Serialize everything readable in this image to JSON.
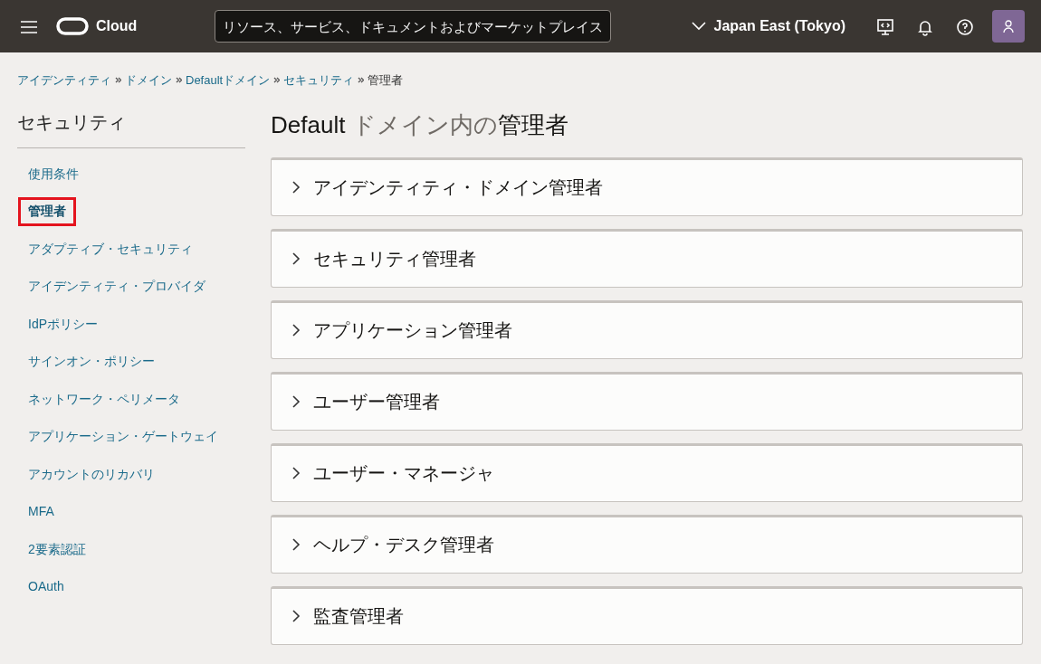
{
  "header": {
    "brand": "Cloud",
    "search": {
      "placeholder": "リソース、サービス、ドキュメントおよびマーケットプレイス"
    },
    "region": "Japan East (Tokyo)"
  },
  "breadcrumb": [
    {
      "label": "アイデンティティ",
      "link": true
    },
    {
      "label": "ドメイン",
      "link": true
    },
    {
      "label": "Defaultドメイン",
      "link": true
    },
    {
      "label": "セキュリティ",
      "link": true
    },
    {
      "label": "管理者",
      "link": false
    }
  ],
  "sidebar": {
    "title": "セキュリティ",
    "items": [
      {
        "label": "使用条件",
        "selected": false
      },
      {
        "label": "管理者",
        "selected": true
      },
      {
        "label": "アダプティブ・セキュリティ",
        "selected": false
      },
      {
        "label": "アイデンティティ・プロバイダ",
        "selected": false
      },
      {
        "label": "IdPポリシー",
        "selected": false
      },
      {
        "label": "サインオン・ポリシー",
        "selected": false
      },
      {
        "label": "ネットワーク・ペリメータ",
        "selected": false
      },
      {
        "label": "アプリケーション・ゲートウェイ",
        "selected": false
      },
      {
        "label": "アカウントのリカバリ",
        "selected": false
      },
      {
        "label": "MFA",
        "selected": false
      },
      {
        "label": "2要素認証",
        "selected": false
      },
      {
        "label": "OAuth",
        "selected": false
      }
    ]
  },
  "title_parts": [
    {
      "text": "Default ",
      "muted": false
    },
    {
      "text": "ドメイン内の",
      "muted": true
    },
    {
      "text": "管理者",
      "muted": false
    }
  ],
  "sections": [
    {
      "label": "アイデンティティ・ドメイン管理者",
      "expanded": false
    },
    {
      "label": "セキュリティ管理者",
      "expanded": false
    },
    {
      "label": "アプリケーション管理者",
      "expanded": false
    },
    {
      "label": "ユーザー管理者",
      "expanded": false
    },
    {
      "label": "ユーザー・マネージャ",
      "expanded": false
    },
    {
      "label": "ヘルプ・デスク管理者",
      "expanded": false
    },
    {
      "label": "監査管理者",
      "expanded": false
    }
  ]
}
